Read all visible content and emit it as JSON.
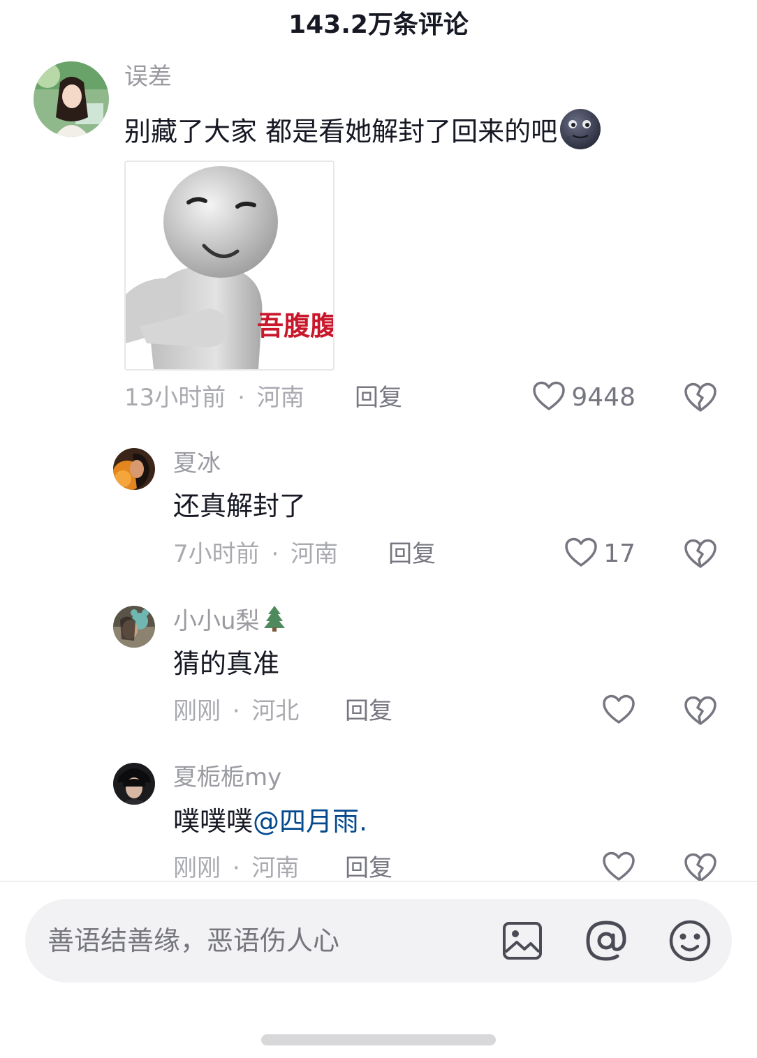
{
  "header": {
    "title": "143.2万条评论"
  },
  "comments": [
    {
      "username": "误差",
      "text": "别藏了大家 都是看她解封了回来的吧",
      "emoji": "moon-face-emoji",
      "sticker": {
        "caption": "吾腹腹"
      },
      "time": "13小时前",
      "region": "河南",
      "reply_label": "回复",
      "likes": "9448"
    },
    {
      "username": "夏冰",
      "text": "还真解封了",
      "time": "7小时前",
      "region": "河南",
      "reply_label": "回复",
      "likes": "17"
    },
    {
      "username": "小小u梨",
      "username_emoji": "tree-emoji",
      "text": "猜的真准",
      "time": "刚刚",
      "region": "河北",
      "reply_label": "回复",
      "likes": ""
    },
    {
      "username": "夏栀栀my",
      "text": "噗噗噗",
      "mention": "@四月雨.",
      "time": "刚刚",
      "region": "河南",
      "reply_label": "回复",
      "likes": ""
    }
  ],
  "meta_separator": "·",
  "input": {
    "placeholder": "善语结善缘，恶语伤人心",
    "icons": [
      "image-icon",
      "at-icon",
      "emoji-icon"
    ]
  },
  "colors": {
    "text_primary": "#161823",
    "text_secondary": "#9a9ba1",
    "mention": "#04498d",
    "input_bg": "#f2f2f4",
    "sticker_caption": "#c9182b"
  }
}
